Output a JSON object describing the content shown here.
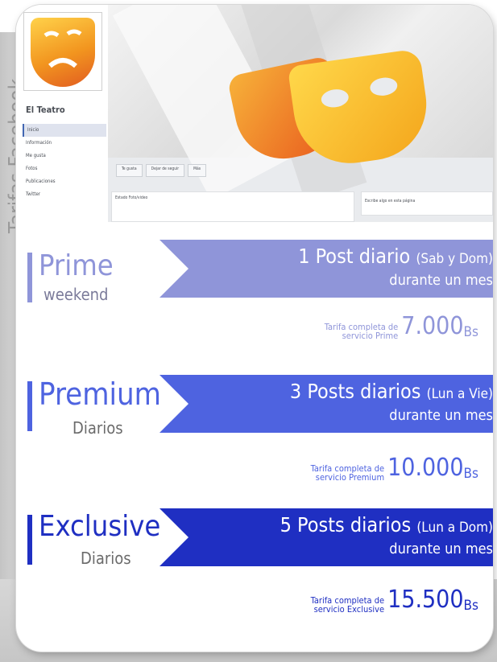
{
  "side_title": "Tarifas Facebook",
  "facebook": {
    "page_name": "El Teatro",
    "menu": [
      "Inicio",
      "Información",
      "Me gusta",
      "Fotos",
      "Publicaciones",
      "Twitter"
    ],
    "actions": [
      "Te gusta",
      "Dejar de seguir",
      "Más"
    ],
    "post_tabs": "Estado   Foto/video",
    "side_box": "Escribe algo en esta página"
  },
  "plans": [
    {
      "name": "Prime",
      "sub": "weekend",
      "line1": "1 Post diario",
      "line1_note": "(Sab y Dom)",
      "line2": "durante un mes",
      "price_label_1": "Tarifa completa de",
      "price_label_2": "servicio Prime",
      "price": "7.000",
      "currency": "Bs",
      "color": "#8f95d9"
    },
    {
      "name": "Premium",
      "sub": "Diarios",
      "line1": "3 Posts diarios",
      "line1_note": "(Lun a Vie)",
      "line2": "durante un mes",
      "price_label_1": "Tarifa completa de",
      "price_label_2": "servicio Premium",
      "price": "10.000",
      "currency": "Bs",
      "color": "#4e63e0"
    },
    {
      "name": "Exclusive",
      "sub": "Diarios",
      "line1": "5 Posts diarios",
      "line1_note": "(Lun a Dom)",
      "line2": "durante un mes",
      "price_label_1": "Tarifa completa de",
      "price_label_2": "servicio Exclusive",
      "price": "15.500",
      "currency": "Bs",
      "color": "#1f2fc2"
    }
  ]
}
